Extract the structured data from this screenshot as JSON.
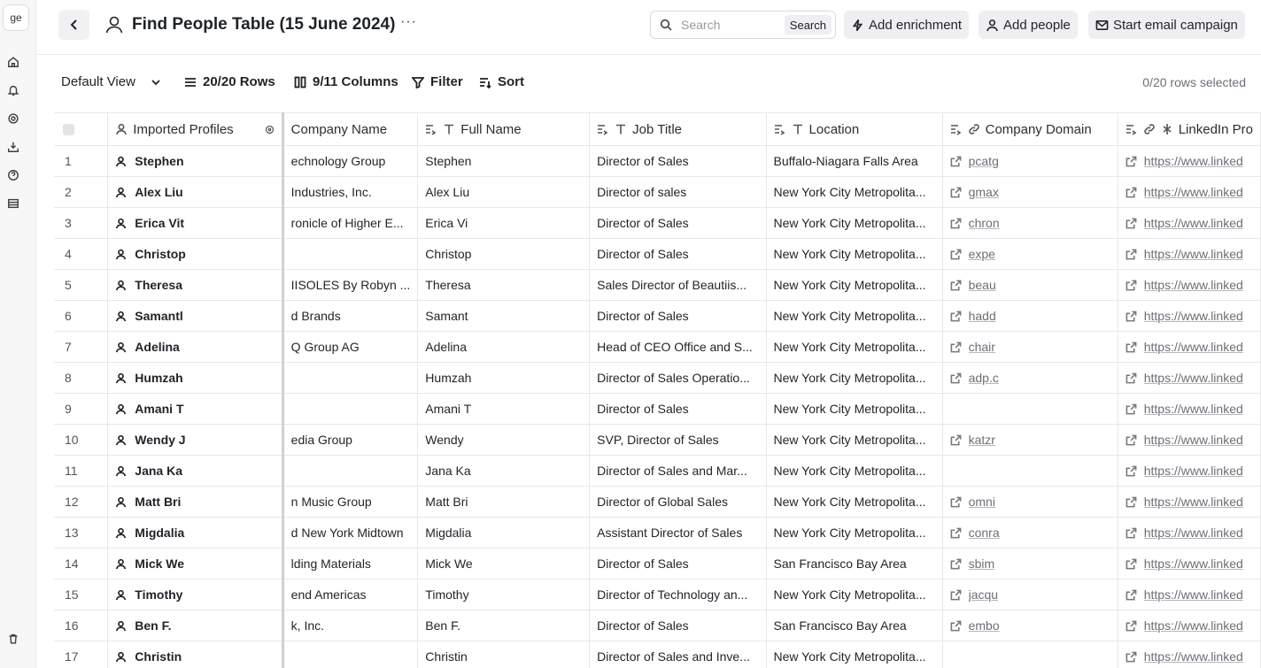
{
  "rail": {
    "workspace_badge": "ge",
    "icons": [
      "home-icon",
      "bell-icon",
      "gear-icon",
      "download-icon",
      "help-icon",
      "table-icon",
      "trash-icon"
    ]
  },
  "header": {
    "title": "Find People Table (15 June 2024)",
    "more": "···",
    "search_placeholder": "Search",
    "search_button": "Search",
    "add_enrichment": "Add enrichment",
    "add_people": "Add people",
    "start_campaign": "Start email campaign"
  },
  "viewbar": {
    "view": "Default View",
    "rows": "20/20 Rows",
    "columns": "9/11 Columns",
    "filter": "Filter",
    "sort": "Sort",
    "selected": "0/20 rows selected"
  },
  "columns": {
    "imported": "Imported Profiles",
    "company": "Company Name",
    "fullname": "Full Name",
    "jobtitle": "Job Title",
    "location": "Location",
    "domain": "Company Domain",
    "linkedin": "LinkedIn Pro"
  },
  "rows": [
    {
      "n": "1",
      "profile": "Stephen",
      "company": "echnology Group",
      "full": "Stephen",
      "job": "Director of Sales",
      "loc": "Buffalo-Niagara Falls Area",
      "domain": "pcatg",
      "li": "https://www.linked"
    },
    {
      "n": "2",
      "profile": "Alex Liu",
      "company": "Industries, Inc.",
      "full": "Alex Liu",
      "job": "Director of sales",
      "loc": "New York City Metropolita...",
      "domain": "gmax",
      "li": "https://www.linked"
    },
    {
      "n": "3",
      "profile": "Erica Vit",
      "company": "ronicle of Higher E...",
      "full": "Erica Vi",
      "job": "Director of Sales",
      "loc": "New York City Metropolita...",
      "domain": "chron",
      "li": "https://www.linked"
    },
    {
      "n": "4",
      "profile": "Christop",
      "company": "",
      "full": "Christop",
      "job": "Director of Sales",
      "loc": "New York City Metropolita...",
      "domain": "expe",
      "li": "https://www.linked"
    },
    {
      "n": "5",
      "profile": "Theresa",
      "company": "IISOLES By Robyn ...",
      "full": "Theresa",
      "job": "Sales Director of Beautiis...",
      "loc": "New York City Metropolita...",
      "domain": "beau",
      "li": "https://www.linked"
    },
    {
      "n": "6",
      "profile": "Samantl",
      "company": "d Brands",
      "full": "Samant",
      "job": "Director of Sales",
      "loc": "New York City Metropolita...",
      "domain": "hadd",
      "li": "https://www.linked"
    },
    {
      "n": "7",
      "profile": "Adelina",
      "company": "Q Group AG",
      "full": "Adelina",
      "job": "Head of CEO Office and S...",
      "loc": "New York City Metropolita...",
      "domain": "chair",
      "li": "https://www.linked"
    },
    {
      "n": "8",
      "profile": "Humzah",
      "company": "",
      "full": "Humzah",
      "job": "Director of Sales Operatio...",
      "loc": "New York City Metropolita...",
      "domain": "adp.c",
      "li": "https://www.linked"
    },
    {
      "n": "9",
      "profile": "Amani T",
      "company": "",
      "full": "Amani T",
      "job": "Director of Sales",
      "loc": "New York City Metropolita...",
      "domain": "",
      "li": "https://www.linked"
    },
    {
      "n": "10",
      "profile": "Wendy J",
      "company": "edia Group",
      "full": "Wendy",
      "job": "SVP, Director of Sales",
      "loc": "New York City Metropolita...",
      "domain": "katzr",
      "li": "https://www.linked"
    },
    {
      "n": "11",
      "profile": "Jana Ka",
      "company": "",
      "full": "Jana Ka",
      "job": "Director of Sales and Mar...",
      "loc": "New York City Metropolita...",
      "domain": "",
      "li": "https://www.linked"
    },
    {
      "n": "12",
      "profile": "Matt Bri",
      "company": "n Music Group",
      "full": "Matt Bri",
      "job": "Director of Global Sales",
      "loc": "New York City Metropolita...",
      "domain": "omni",
      "li": "https://www.linked"
    },
    {
      "n": "13",
      "profile": "Migdalia",
      "company": "d New York Midtown",
      "full": "Migdalia",
      "job": "Assistant Director of Sales",
      "loc": "New York City Metropolita...",
      "domain": "conra",
      "li": "https://www.linked"
    },
    {
      "n": "14",
      "profile": "Mick We",
      "company": "lding Materials",
      "full": "Mick We",
      "job": "Director of Sales",
      "loc": "San Francisco Bay Area",
      "domain": "sbim",
      "li": "https://www.linked"
    },
    {
      "n": "15",
      "profile": "Timothy",
      "company": "end Americas",
      "full": "Timothy",
      "job": "Director of Technology an...",
      "loc": "New York City Metropolita...",
      "domain": "jacqu",
      "li": "https://www.linked"
    },
    {
      "n": "16",
      "profile": "Ben F.",
      "company": "k, Inc.",
      "full": "Ben F.",
      "job": "Director of Sales",
      "loc": "San Francisco Bay Area",
      "domain": "embo",
      "li": "https://www.linked"
    },
    {
      "n": "17",
      "profile": "Christin",
      "company": "",
      "full": "Christin",
      "job": "Director of Sales and Inve...",
      "loc": "New York City Metropolita...",
      "domain": "",
      "li": "https://www.linked"
    }
  ]
}
